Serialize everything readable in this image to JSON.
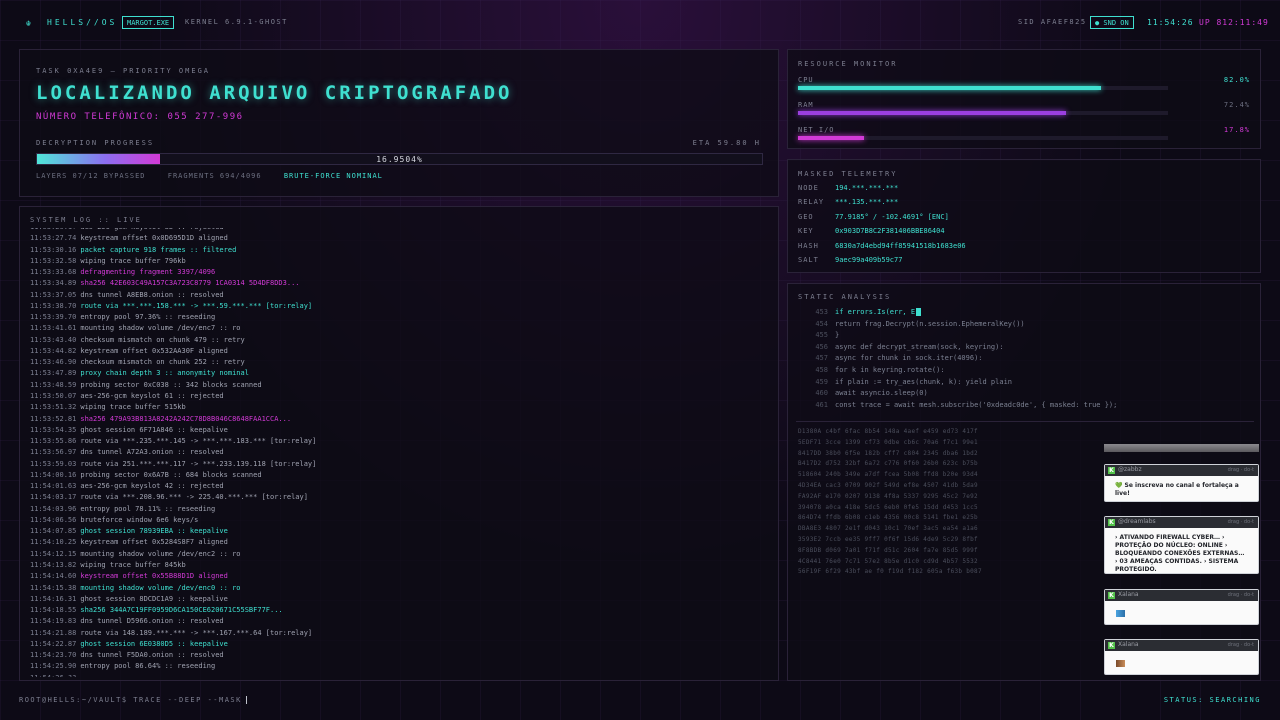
{
  "topbar": {
    "logo_glyph": "☬",
    "brand": "HELLS//OS",
    "process": "MARGOT.EXE",
    "kernel": "KERNEL 6.9.1-GHOST",
    "sid": "SID AFAEF825",
    "snd": "● SND ON",
    "clock": "11:54:26",
    "uptime": "UP 812:11:49"
  },
  "task": {
    "id": "TASK 0XA4E9 — PRIORITY OMEGA",
    "title": "LOCALIZANDO ARQUIVO CRIPTOGRAFADO",
    "phone": "NÚMERO TELEFÔNICO: 055 277-996",
    "progress_label": "DECRYPTION PROGRESS",
    "eta": "ETA 59.80 H",
    "progress_pct": 16.9504,
    "progress_text": "16.9504%",
    "layers": "LAYERS 07/12 BYPASSED",
    "fragments": "FRAGMENTS 694/4096",
    "bruteforce": "BRUTE-FORCE NOMINAL"
  },
  "resources": {
    "title": "RESOURCE MONITOR",
    "items": [
      {
        "label": "CPU",
        "value_text": "82.0%",
        "value": 82.0,
        "color": "#3fe0d0"
      },
      {
        "label": "RAM",
        "value_text": "72.4%",
        "value": 72.4,
        "color": "#9b3fe0"
      },
      {
        "label": "NET I/O",
        "value_text": "17.8%",
        "value": 17.8,
        "color": "#d23ad6"
      }
    ]
  },
  "telemetry": {
    "title": "MASKED TELEMETRY",
    "rows": [
      {
        "key": "NODE",
        "value": "194.***.***.***"
      },
      {
        "key": "RELAY",
        "value": "***.135.***.***"
      },
      {
        "key": "GEO",
        "value": "77.9185° / -102.4691° [ENC]"
      },
      {
        "key": "KEY",
        "value": "0x903D7B8C2F381406BBE86404"
      },
      {
        "key": "HASH",
        "value": "6830a7d4ebd94ff85941518b1683e06"
      },
      {
        "key": "SALT",
        "value": "9aec99a409b59c77"
      }
    ]
  },
  "static": {
    "title": "STATIC ANALYSIS",
    "code": [
      {
        "ln": "453",
        "text": "if errors.Is(err, E",
        "active": true
      },
      {
        "ln": "454",
        "text": "return frag.Decrypt(n.session.EphemeralKey())",
        "active": false
      },
      {
        "ln": "455",
        "text": "}",
        "active": false
      },
      {
        "ln": "456",
        "text": "async def decrypt_stream(sock, keyring):",
        "active": false
      },
      {
        "ln": "457",
        "text": "async for chunk in sock.iter(4096):",
        "active": false
      },
      {
        "ln": "458",
        "text": "for k in keyring.rotate():",
        "active": false
      },
      {
        "ln": "459",
        "text": "if plain := try_aes(chunk, k): yield plain",
        "active": false
      },
      {
        "ln": "460",
        "text": "await asyncio.sleep(0)",
        "active": false
      },
      {
        "ln": "461",
        "text": "const trace = await mesh.subscribe('0xdeadc0de', { masked: true });",
        "active": false
      }
    ],
    "hex": [
      "D1380A  c4bf 6fac 8b54 148a 4aef e459 ed73 417f",
      "5EDF71  3cce 1399 cf73 0dbe cb6c 70a6 f7c1 99e1",
      "8417DD  38b0 6f5e 182b cff7 c804 2345 dba6 1bd2",
      "B417D2  d752 32bf 6a72 c776 0f60 26b0 623c b75b",
      "518604  240b 349e a7df fcea 5b08 ffd8 b20e 93d4",
      "4D34EA  cac3 0709 902f 549d ef8e 4507 41db 5da9",
      "FA92AF  e170 0207 9138 4f8a 5337 9295 45c2 7e92",
      "394078  a0ca 418e 5dc5 6eb0 0fe5 15dd d453 1cc5",
      "864D74  ffdb 6b08 c1eb 4356 00c8 5141 fbe1 e25b",
      "DBA8E3  4807 2e1f d043 10c1 70ef 3ac5 ea54 a1a6",
      "3593E2  7ccb ee35 9ff7 0f6f 15d6 4de9 5c29 8fbf",
      "8F8BDB  d069 7a01 f71f d51c 2604 fa7e 85d5 999f",
      "4C8441  76e0 7c71 57e2 8b5e d1c0 cd9d 4b57 5532",
      "56F19F  6f29 43bf ae f0 f19d f182 605a f63b b087"
    ]
  },
  "chats": [
    {
      "user": "@zabbz",
      "meta": "drag · do-t",
      "message": "💚 Se inscreva no canal e fortaleça a live!"
    },
    {
      "user": "@dreamlabs",
      "meta": "drag · do-t",
      "message": "› ATIVANDO FIREWALL CYBER… › PROTEÇÃO DO NÚCLEO: ONLINE › BLOQUEANDO CONEXÕES EXTERNAS… › 03 AMEAÇAS CONTIDAS. › SISTEMA PROTEGIDO."
    },
    {
      "user": "Xalana",
      "meta": "drag · do-t",
      "message": ""
    },
    {
      "user": "Xalana",
      "meta": "drag · do-t",
      "message": ""
    }
  ],
  "log": {
    "title": "SYSTEM LOG :: LIVE",
    "lines": [
      {
        "t": "11:53:26.1?",
        "m": "aes-256-gcm keyslot 8b :: rejected",
        "c": "n"
      },
      {
        "t": "11:53:27.74",
        "m": "keystream offset 0x0D695D1D aligned",
        "c": "n"
      },
      {
        "t": "11:53:30.16",
        "m": "packet capture 918 frames :: filtered",
        "c": "c"
      },
      {
        "t": "11:53:32.58",
        "m": "wiping trace buffer 796kb",
        "c": "n"
      },
      {
        "t": "11:53:33.68",
        "m": "defragmenting fragment 3397/4096",
        "c": "p"
      },
      {
        "t": "11:53:34.89",
        "m": "sha256 42E603C49A157C3A723C8779 1CA0314 5D4DF8DD3...",
        "c": "p"
      },
      {
        "t": "11:53:37.05",
        "m": "dns tunnel A8EB8.onion :: resolved",
        "c": "n"
      },
      {
        "t": "11:53:38.70",
        "m": "route via ***.***.158.*** -> ***.59.***.*** [tor:relay]",
        "c": "c"
      },
      {
        "t": "11:53:39.70",
        "m": "entropy pool 97.36% :: reseeding",
        "c": "n"
      },
      {
        "t": "11:53:41.61",
        "m": "mounting shadow volume /dev/enc7 :: ro",
        "c": "n"
      },
      {
        "t": "11:53:43.40",
        "m": "checksum mismatch on chunk 479 :: retry",
        "c": "n"
      },
      {
        "t": "11:53:44.82",
        "m": "keystream offset 0x532AA30F aligned",
        "c": "n"
      },
      {
        "t": "11:53:46.90",
        "m": "checksum mismatch on chunk 252 :: retry",
        "c": "n"
      },
      {
        "t": "11:53:47.89",
        "m": "proxy chain depth 3 :: anonymity nominal",
        "c": "c"
      },
      {
        "t": "11:53:48.59",
        "m": "probing sector 0xC038 :: 342 blocks scanned",
        "c": "n"
      },
      {
        "t": "11:53:50.07",
        "m": "aes-256-gcm keyslot 61 :: rejected",
        "c": "n"
      },
      {
        "t": "11:53:51.32",
        "m": "wiping trace buffer 515kb",
        "c": "n"
      },
      {
        "t": "11:53:52.81",
        "m": "sha256 479A93B813A8242A242C78D8B046C8648FAA1CCA...",
        "c": "p"
      },
      {
        "t": "11:53:54.35",
        "m": "ghost session 6F71A846 :: keepalive",
        "c": "n"
      },
      {
        "t": "11:53:55.86",
        "m": "route via ***.235.***.145 -> ***.***.183.*** [tor:relay]",
        "c": "n"
      },
      {
        "t": "11:53:56.97",
        "m": "dns tunnel A72A3.onion :: resolved",
        "c": "n"
      },
      {
        "t": "11:53:59.03",
        "m": "route via 251.***.***.117 -> ***.233.139.118 [tor:relay]",
        "c": "n"
      },
      {
        "t": "11:54:00.16",
        "m": "probing sector 0x6A7B :: 684 blocks scanned",
        "c": "n"
      },
      {
        "t": "11:54:01.63",
        "m": "aes-256-gcm keyslot 42 :: rejected",
        "c": "n"
      },
      {
        "t": "11:54:03.17",
        "m": "route via ***.208.96.*** -> 225.40.***.*** [tor:relay]",
        "c": "n"
      },
      {
        "t": "11:54:03.96",
        "m": "entropy pool 78.11% :: reseeding",
        "c": "n"
      },
      {
        "t": "11:54:06.56",
        "m": "bruteforce window 6e6 keys/s",
        "c": "n"
      },
      {
        "t": "11:54:07.85",
        "m": "ghost session 78939EBA :: keepalive",
        "c": "c"
      },
      {
        "t": "11:54:10.25",
        "m": "keystream offset 0x5284S8F7 aligned",
        "c": "n"
      },
      {
        "t": "11:54:12.15",
        "m": "mounting shadow volume /dev/enc2 :: ro",
        "c": "n"
      },
      {
        "t": "11:54:13.82",
        "m": "wiping trace buffer 845kb",
        "c": "n"
      },
      {
        "t": "11:54:14.60",
        "m": "keystream offset 0x55B88D1D aligned",
        "c": "p"
      },
      {
        "t": "11:54:15.38",
        "m": "mounting shadow volume /dev/enc0 :: ro",
        "c": "c"
      },
      {
        "t": "11:54:16.31",
        "m": "ghost session 8DCDC1A9 :: keepalive",
        "c": "n"
      },
      {
        "t": "11:54:18.55",
        "m": "sha256 344A7C19FF0959D6CA150CE620671C55SBF77F...",
        "c": "c"
      },
      {
        "t": "11:54:19.83",
        "m": "dns tunnel D5966.onion :: resolved",
        "c": "n"
      },
      {
        "t": "11:54:21.88",
        "m": "route via 148.189.***.*** -> ***.167.***.64 [tor:relay]",
        "c": "n"
      },
      {
        "t": "11:54:22.87",
        "m": "ghost session 6E0380D5 :: keepalive",
        "c": "c"
      },
      {
        "t": "11:54:23.70",
        "m": "dns tunnel F5DA0.onion :: resolved",
        "c": "n"
      },
      {
        "t": "11:54:25.90",
        "m": "entropy pool 86.64% :: reseeding",
        "c": "n"
      },
      {
        "t": "11:54:26.??",
        "m": "......",
        "c": "n"
      }
    ]
  },
  "bottom": {
    "command": "ROOT@HELLS:~/VAULT$ TRACE --DEEP --MASK",
    "status": "STATUS: SEARCHING"
  }
}
